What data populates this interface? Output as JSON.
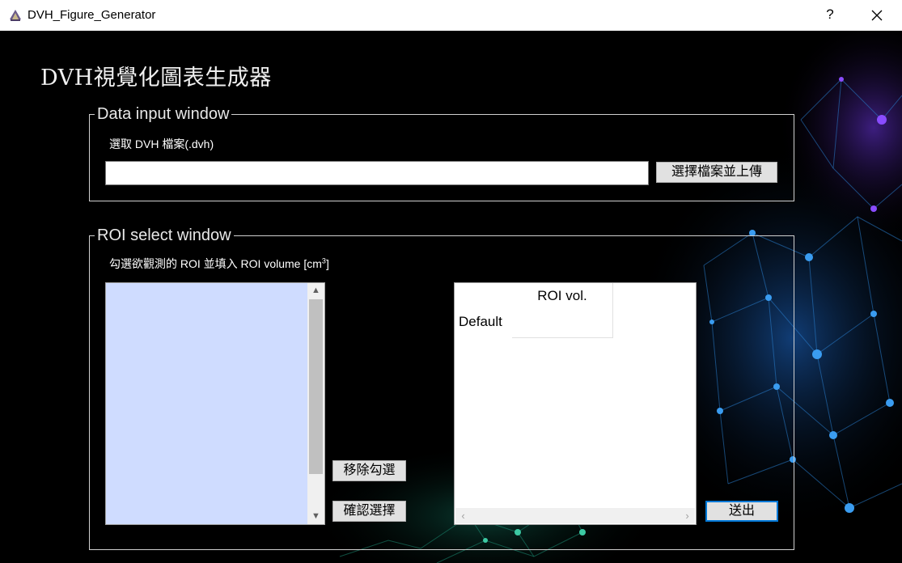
{
  "window": {
    "title": "DVH_Figure_Generator",
    "help": "?",
    "close_icon": "close-icon",
    "app_icon": "python-feather-icon"
  },
  "header": {
    "title": "DVH視覺化圖表生成器"
  },
  "data_input": {
    "group_title": "Data input window",
    "label": "選取 DVH 檔案(.dvh)",
    "file_path_value": "",
    "upload_button": "選擇檔案並上傳"
  },
  "roi_select": {
    "group_title": "ROI select window",
    "instruction_prefix": "勾選欲觀測的 ROI 並填入 ROI volume [cm",
    "instruction_sup": "3",
    "instruction_suffix": "]",
    "roi_list_items": [],
    "remove_button": "移除勾選",
    "confirm_button": "確認選擇",
    "table": {
      "column_header": "ROI vol.",
      "row_header": "Default"
    },
    "submit_button": "送出"
  },
  "colors": {
    "background": "#000000",
    "listbox": "#cfdcff",
    "accent": "#0078d7"
  }
}
